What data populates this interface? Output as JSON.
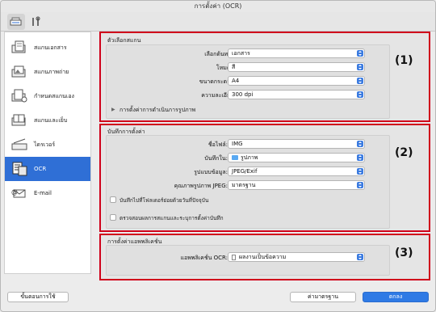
{
  "window": {
    "title": "การตั้งค่า (OCR)"
  },
  "toolbar": {
    "tabs": [
      {
        "icon": "scanner-settings-icon",
        "active": true
      },
      {
        "icon": "tools-icon",
        "active": false
      }
    ]
  },
  "sidebar": {
    "items": [
      {
        "label": "สแกนเอกสาร",
        "icon": "document-scan-icon",
        "selected": false
      },
      {
        "label": "สแกนภาพถ่าย",
        "icon": "photo-scan-icon",
        "selected": false
      },
      {
        "label": "กำหนดสแกนเอง",
        "icon": "custom-scan-icon",
        "selected": false
      },
      {
        "label": "สแกนและเย็บ",
        "icon": "scan-stitch-icon",
        "selected": false
      },
      {
        "label": "ไดรเวอร์",
        "icon": "driver-icon",
        "selected": false
      },
      {
        "label": "OCR",
        "icon": "ocr-icon",
        "selected": true
      },
      {
        "label": "E-mail",
        "icon": "email-icon",
        "selected": false
      }
    ]
  },
  "scan_options": {
    "title": "ตัวเลือกสแกน",
    "number": "(1)",
    "source_label": "เลือกต้นทาง:",
    "source_value": "เอกสาร",
    "color_label": "โหมดสี:",
    "color_value": "สี",
    "paper_label": "ขนาดกระดาษ:",
    "paper_value": "A4",
    "resolution_label": "ความละเอียด:",
    "resolution_value": "300 dpi",
    "image_processing_label": "การตั้งค่าการดำเนินการรูปภาพ"
  },
  "save_settings": {
    "title": "บันทึกการตั้งค่า",
    "number": "(2)",
    "filename_label": "ชื่อไฟล์:",
    "filename_value": "IMG",
    "save_in_label": "บันทึกใน:",
    "save_in_value": "รูปภาพ",
    "format_label": "รูปแบบข้อมูล:",
    "format_value": "JPEG/Exif",
    "quality_label": "คุณภาพรูปภาพ JPEG:",
    "quality_value": "มาตรฐาน",
    "subfolder_checkbox": "บันทึกไปที่โฟลเดอร์ย่อยด้วยวันที่ปัจจุบัน",
    "check_results_checkbox": "ตรวจสอบผลการสแกนและระบุการตั้งค่าบันทึก"
  },
  "app_settings": {
    "title": "การตั้งค่าแอพพลิเคชั่น",
    "number": "(3)",
    "app_label": "แอพพลิเคชั่น OCR:",
    "app_value": "ผลงานเป็นข้อความ"
  },
  "footer": {
    "instructions_label": "ขั้นตอนการใช้",
    "defaults_label": "ค่ามาตรฐาน",
    "ok_label": "ตกลง"
  }
}
